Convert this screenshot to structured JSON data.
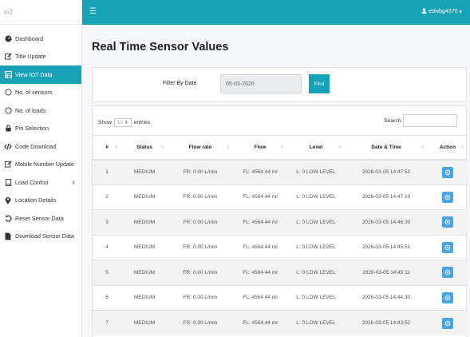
{
  "brand": "IoT",
  "colors": {
    "accent": "#17a2b8",
    "action": "#4aa3e3"
  },
  "sidebar": {
    "items": [
      {
        "label": "Dashboard",
        "icon": "dashboard-icon"
      },
      {
        "label": "Title Update",
        "icon": "edit-icon"
      },
      {
        "label": "View IOT Data",
        "icon": "table-icon",
        "active": true
      },
      {
        "label": "No. of sensors",
        "icon": "circle-icon"
      },
      {
        "label": "No. of loads",
        "icon": "circle-icon"
      },
      {
        "label": "Pin Selection",
        "icon": "lock-icon"
      },
      {
        "label": "Code Download",
        "icon": "code-icon"
      },
      {
        "label": "Mobile Number Update",
        "icon": "edit-icon"
      },
      {
        "label": "Load Control",
        "icon": "tablet-icon"
      },
      {
        "label": "Location Details",
        "icon": "map-marker-icon"
      },
      {
        "label": "Reset Sensor Data",
        "icon": "undo-icon"
      },
      {
        "label": "Download Sensor Data",
        "icon": "file-icon"
      }
    ]
  },
  "topbar": {
    "user": "edwbg4370"
  },
  "page": {
    "title": "Real Time Sensor Values"
  },
  "filter": {
    "label": "Filter By Date",
    "date": "05-03-2026",
    "button": "Find"
  },
  "table": {
    "show": "Show",
    "entries_value": "10",
    "entries": "entries",
    "search_label": "Search:",
    "headers": [
      "#",
      "Status",
      "Flow rate",
      "Flow",
      "Level",
      "Date & Time",
      "Action"
    ],
    "rows": [
      [
        "1",
        "MEDIUM",
        "FR: 0.00 L/min",
        "FL: 4564.44 ml",
        "L: 0 LOW LEVEL",
        "2026-03-05 14:47:52"
      ],
      [
        "2",
        "MEDIUM",
        "FR: 0.00 L/min",
        "FL: 4564.44 ml",
        "L: 0 LOW LEVEL",
        "2026-03-05 14:47:10"
      ],
      [
        "3",
        "MEDIUM",
        "FR: 0.00 L/min",
        "FL: 4564.44 ml",
        "L: 0 LOW LEVEL",
        "2026-03-05 14:46:30"
      ],
      [
        "4",
        "MEDIUM",
        "FR: 0.00 L/min",
        "FL: 4564.44 ml",
        "L: 0 LOW LEVEL",
        "2026-03-05 14:45:51"
      ],
      [
        "5",
        "MEDIUM",
        "FR: 0.00 L/min",
        "FL: 4564.44 ml",
        "L: 0 LOW LEVEL",
        "2026-03-05 14:45:11"
      ],
      [
        "6",
        "MEDIUM",
        "FR: 0.00 L/min",
        "FL: 4564.44 ml",
        "L: 0 LOW LEVEL",
        "2026-03-05 14:44:30"
      ],
      [
        "7",
        "MEDIUM",
        "FR: 0.00 L/min",
        "FL: 4564.44 ml",
        "L: 0 LOW LEVEL",
        "2026-03-05 14:43:52"
      ]
    ]
  }
}
